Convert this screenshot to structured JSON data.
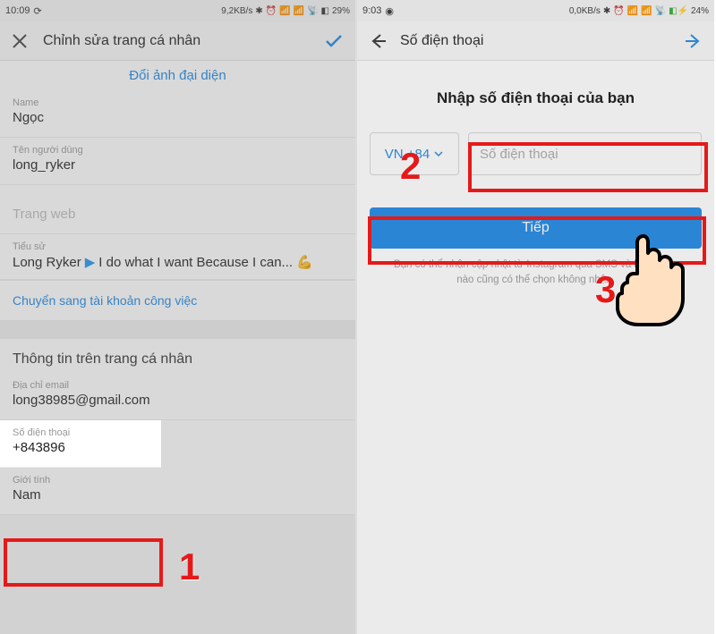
{
  "left": {
    "status": {
      "time": "10:09",
      "speed": "9,2KB/s",
      "battery": "29%"
    },
    "header": {
      "title": "Chỉnh sửa trang cá nhân"
    },
    "changePhoto": "Đổi ảnh đại diện",
    "fields": {
      "name": {
        "label": "Name",
        "value": "Ngọc"
      },
      "username": {
        "label": "Tên người dùng",
        "value": "long_ryker"
      },
      "website": {
        "label": "Trang web",
        "value": ""
      },
      "bio": {
        "label": "Tiểu sử",
        "name": "Long Ryker",
        "rest": "I do what I want Because I can... 💪"
      }
    },
    "switchBusiness": "Chuyển sang tài khoản công việc",
    "profileInfoTitle": "Thông tin trên trang cá nhân",
    "email": {
      "label": "Địa chỉ email",
      "value": "long38985@gmail.com"
    },
    "phone": {
      "label": "Số điện thoại",
      "value": "+843896"
    },
    "gender": {
      "label": "Giới tính",
      "value": "Nam"
    },
    "step1": "1"
  },
  "right": {
    "status": {
      "time": "9:03",
      "speed": "0,0KB/s",
      "battery": "24%"
    },
    "header": {
      "title": "Số điện thoại"
    },
    "heading": "Nhập số điện thoại của bạn",
    "countryCode": "VN +84",
    "phonePlaceholder": "Số điện thoại",
    "nextBtn": "Tiếp",
    "helper": "Bạn có thể nhận cập nhật từ Instagram qua SMS và bất kỳ lúc nào cũng có thể chọn không nhận.",
    "step2": "2",
    "step3": "3"
  }
}
